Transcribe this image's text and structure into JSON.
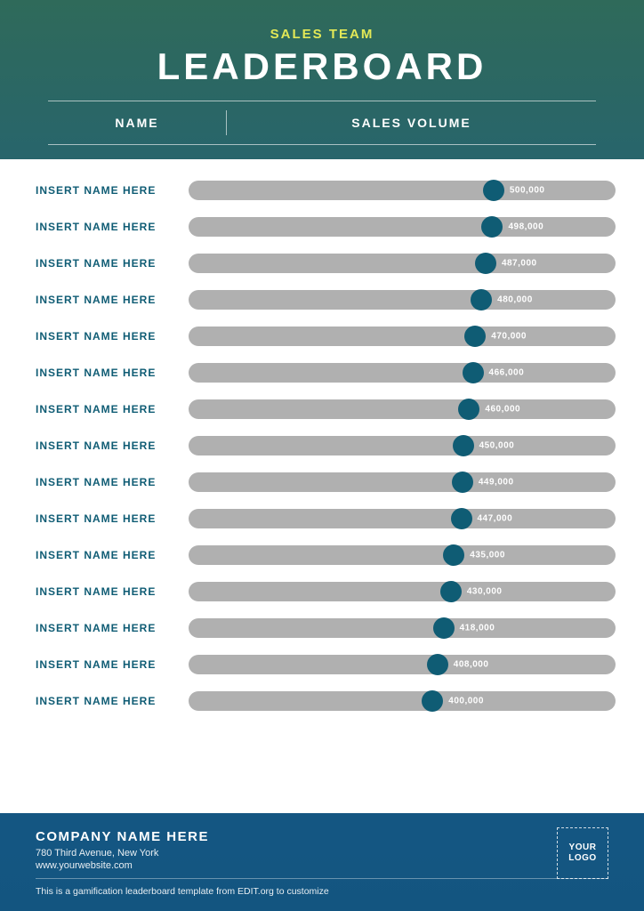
{
  "header": {
    "subtitle": "SALES TEAM",
    "title": "LEADERBOARD",
    "col_name": "NAME",
    "col_sales": "SALES VOLUME"
  },
  "footer": {
    "company": "COMPANY NAME HERE",
    "address": "780 Third Avenue, New York",
    "url": "www.yourwebsite.com",
    "note": "This is a gamification leaderboard template from EDIT.org to customize",
    "logo_line1": "YOUR",
    "logo_line2": "LOGO"
  },
  "chart_data": {
    "type": "bar",
    "title": "LEADERBOARD",
    "xlabel": "SALES VOLUME",
    "ylabel": "NAME",
    "max": 700000,
    "rows": [
      {
        "name": "INSERT NAME HERE",
        "value": 500000,
        "label": "500,000"
      },
      {
        "name": "INSERT NAME HERE",
        "value": 498000,
        "label": "498,000"
      },
      {
        "name": "INSERT NAME HERE",
        "value": 487000,
        "label": "487,000"
      },
      {
        "name": "INSERT NAME HERE",
        "value": 480000,
        "label": "480,000"
      },
      {
        "name": "INSERT NAME HERE",
        "value": 470000,
        "label": "470,000"
      },
      {
        "name": "INSERT NAME HERE",
        "value": 466000,
        "label": "466,000"
      },
      {
        "name": "INSERT NAME HERE",
        "value": 460000,
        "label": "460,000"
      },
      {
        "name": "INSERT NAME HERE",
        "value": 450000,
        "label": "450,000"
      },
      {
        "name": "INSERT NAME HERE",
        "value": 449000,
        "label": "449,000"
      },
      {
        "name": "INSERT NAME HERE",
        "value": 447000,
        "label": "447,000"
      },
      {
        "name": "INSERT NAME HERE",
        "value": 435000,
        "label": "435,000"
      },
      {
        "name": "INSERT NAME HERE",
        "value": 430000,
        "label": "430,000"
      },
      {
        "name": "INSERT NAME HERE",
        "value": 418000,
        "label": "418,000"
      },
      {
        "name": "INSERT NAME HERE",
        "value": 408000,
        "label": "408,000"
      },
      {
        "name": "INSERT NAME HERE",
        "value": 400000,
        "label": "400,000"
      }
    ]
  }
}
